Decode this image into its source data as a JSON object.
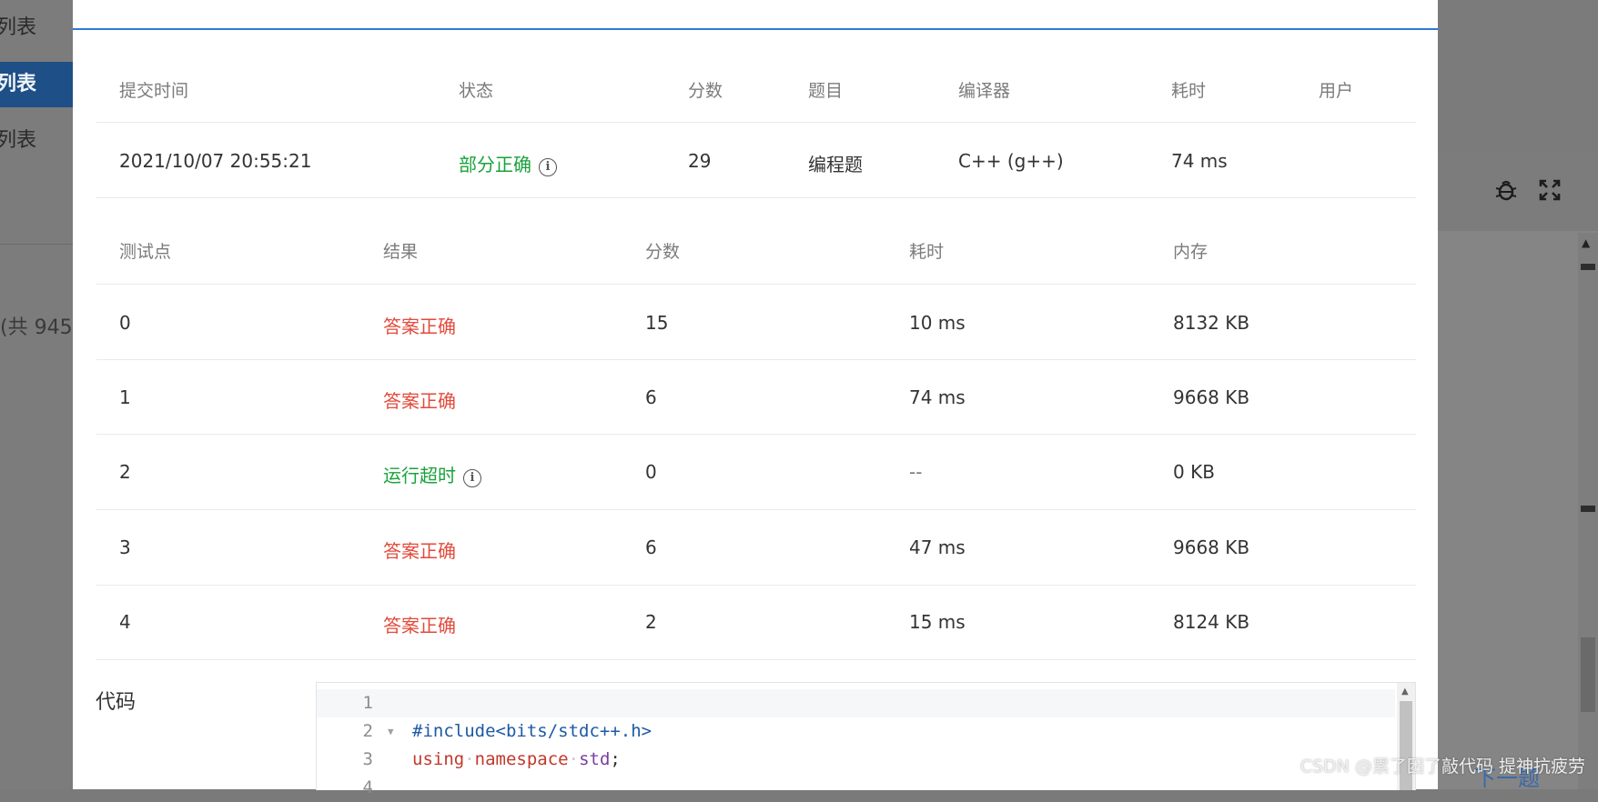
{
  "background": {
    "sidebar_items": [
      "列表",
      "列表",
      "列表"
    ],
    "count_text": "(共 945",
    "next_button": "下一题"
  },
  "submission": {
    "headers": [
      "提交时间",
      "状态",
      "分数",
      "题目",
      "编译器",
      "耗时",
      "用户"
    ],
    "row": {
      "time": "2021/10/07 20:55:21",
      "status": "部分正确",
      "score": "29",
      "problem": "编程题",
      "compiler": "C++ (g++)",
      "duration": "74 ms",
      "user": ""
    }
  },
  "testcases": {
    "headers": [
      "测试点",
      "结果",
      "分数",
      "耗时",
      "内存"
    ],
    "rows": [
      {
        "id": "0",
        "result": "答案正确",
        "score": "15",
        "time": "10 ms",
        "memory": "8132 KB"
      },
      {
        "id": "1",
        "result": "答案正确",
        "score": "6",
        "time": "74 ms",
        "memory": "9668 KB"
      },
      {
        "id": "2",
        "result": "运行超时",
        "score": "0",
        "time": "--",
        "memory": "0 KB"
      },
      {
        "id": "3",
        "result": "答案正确",
        "score": "6",
        "time": "47 ms",
        "memory": "9668 KB"
      },
      {
        "id": "4",
        "result": "答案正确",
        "score": "2",
        "time": "15 ms",
        "memory": "8124 KB"
      }
    ]
  },
  "code": {
    "label": "代码",
    "line_numbers": [
      "1",
      "2",
      "3",
      "4"
    ],
    "line2": "#include<bits/stdc++.h>",
    "line3_kw1": "using",
    "line3_kw2": "namespace",
    "line3_ns": "std",
    "line3_end": ";"
  },
  "watermark": "CSDN @累了困了敲代码 提神抗疲劳",
  "colors": {
    "accent": "#2d7ad6",
    "correct": "#e24b3b",
    "partial": "#19a23b"
  }
}
